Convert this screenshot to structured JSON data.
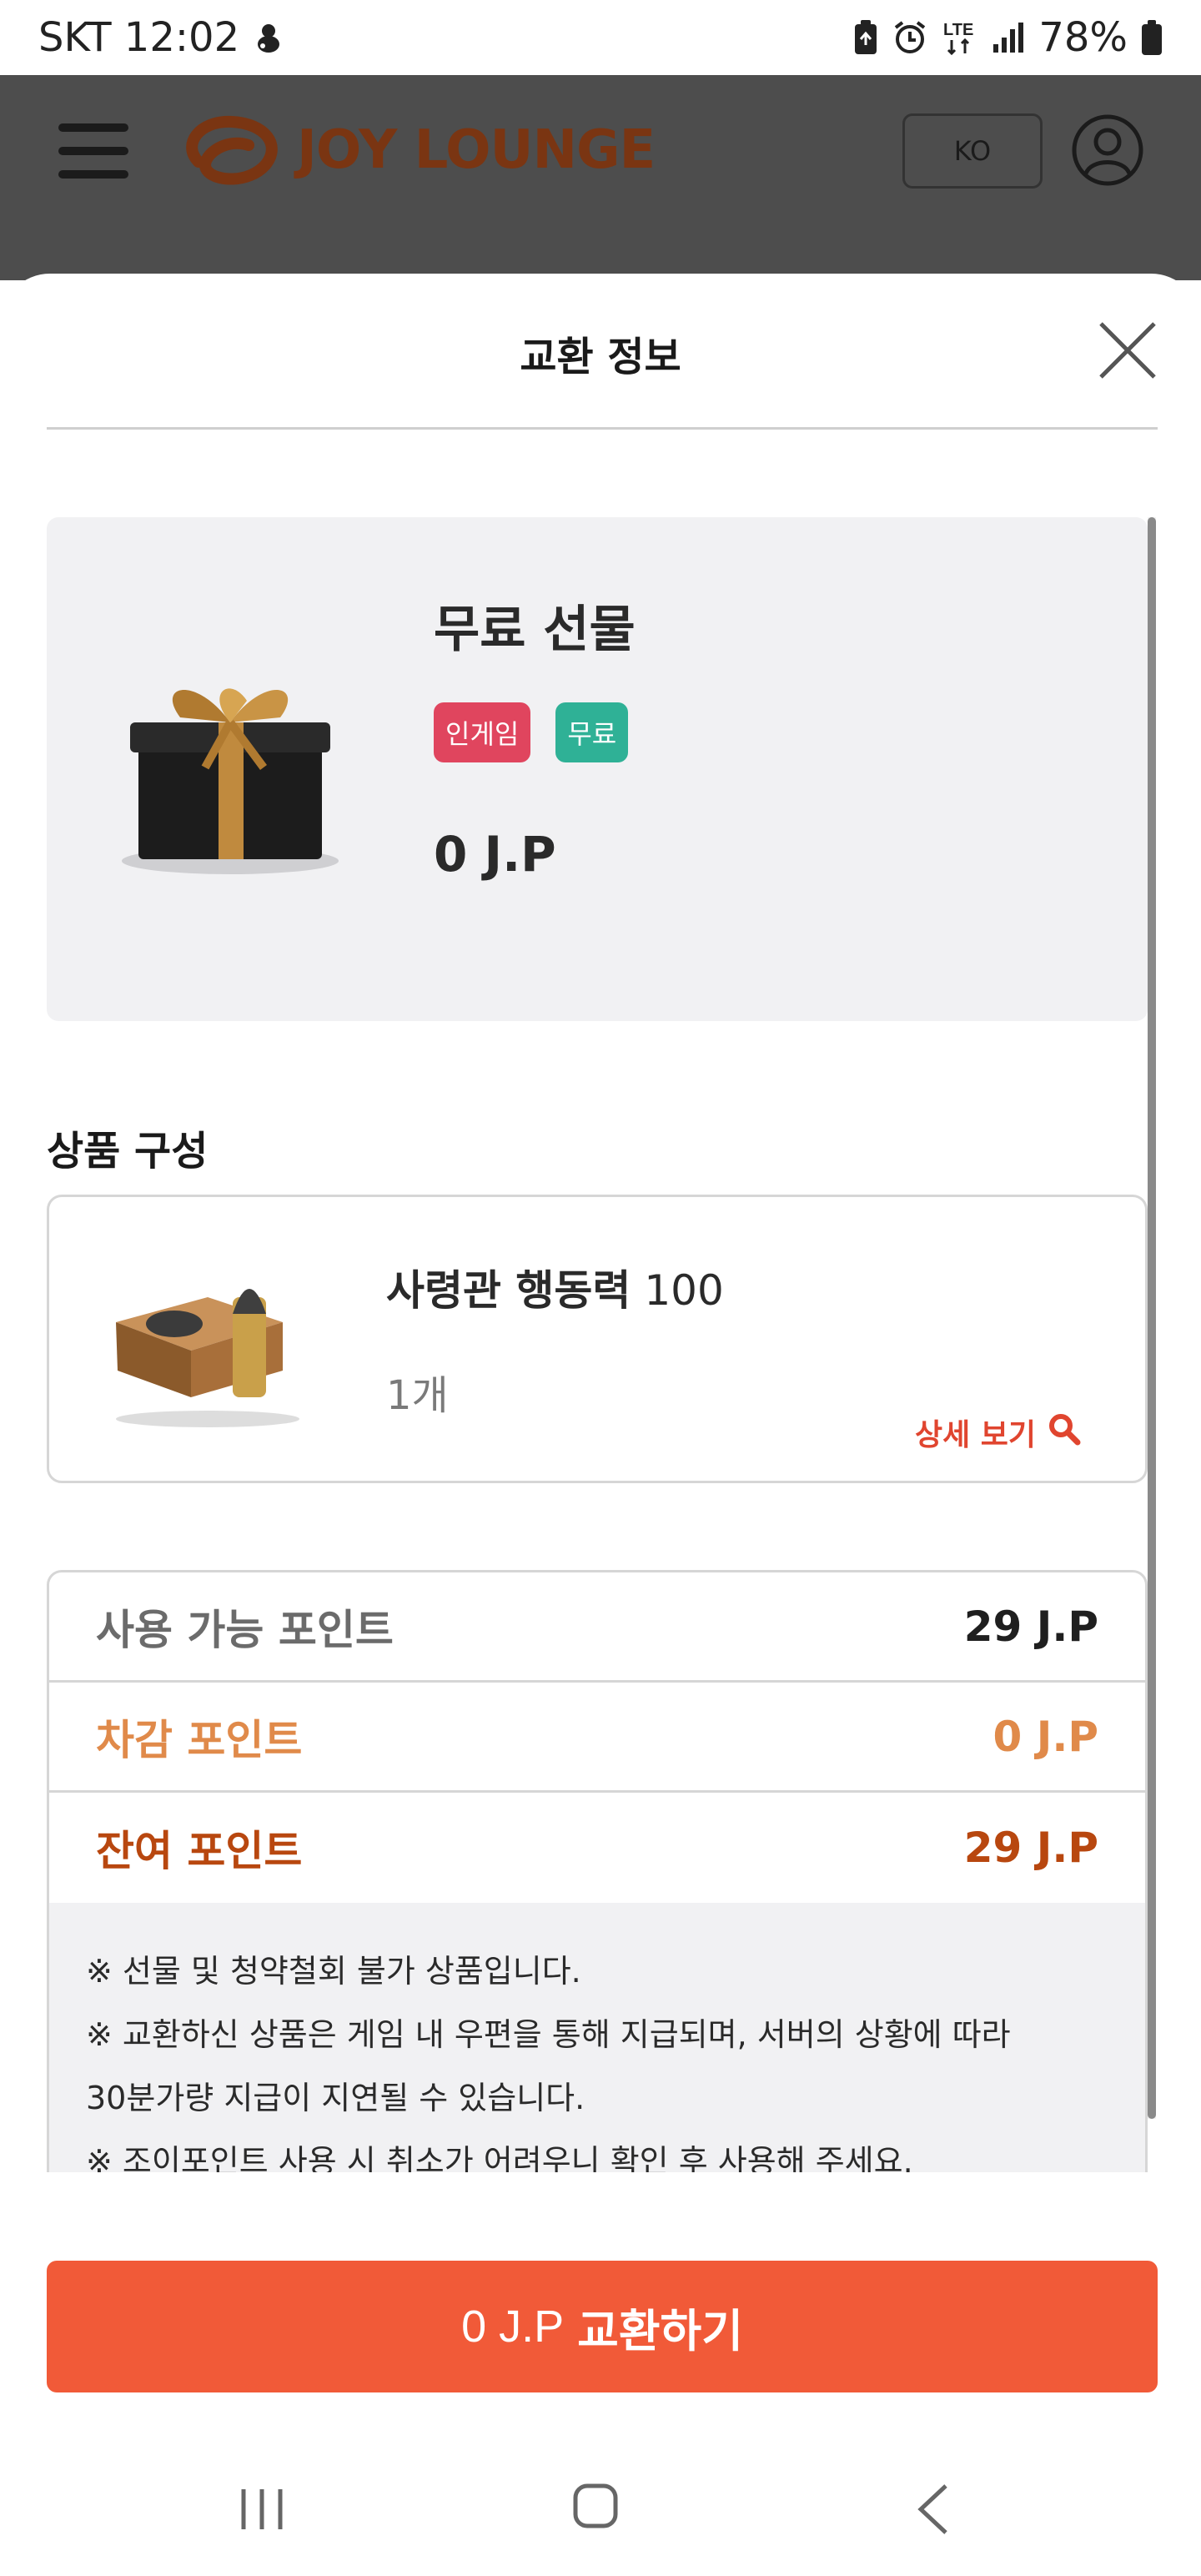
{
  "status_bar": {
    "carrier_time": "SKT 12:02",
    "battery": "78%",
    "network": "LTE"
  },
  "header": {
    "logo_text": "JOY LOUNGE",
    "lang_button": "KO"
  },
  "modal": {
    "title": "교환 정보",
    "product": {
      "name": "무료 선물",
      "tags": [
        "인게임",
        "무료"
      ],
      "price": "0 J.P"
    },
    "contents_section": {
      "title": "상품 구성",
      "item_name_bold": "사령관 행동력",
      "item_name_value": " 100",
      "item_qty": "1개",
      "detail_link": "상세 보기"
    },
    "points": {
      "available_label": "사용 가능 포인트",
      "available_value": "29 J.P",
      "deduct_label": "차감 포인트",
      "deduct_value": "0 J.P",
      "remain_label": "잔여 포인트",
      "remain_value": "29 J.P"
    },
    "notes": [
      "※ 선물 및 청약철회 불가 상품입니다.",
      "※ 교환하신 상품은 게임 내 우편을 통해 지급되며, 서버의 상황에 따라",
      "30분가량 지급이 지연될 수 있습니다.",
      "※ 조이포인트 사용 시 취소가 어려우니 확인 후 사용해 주세요."
    ],
    "exchange_button": {
      "amount": "0 J.P",
      "verb": "교환하기"
    }
  },
  "colors": {
    "accent": "#f15a38",
    "tag_ingame": "#e0455e",
    "tag_free": "#2fb196",
    "deduct": "#e08a4a",
    "remain": "#b8470f"
  },
  "icons": [
    "tamagotchi-icon",
    "battery-saver-icon",
    "alarm-icon",
    "lte-icon",
    "signal-icon",
    "battery-icon",
    "menu-icon",
    "joy-lounge-logo",
    "user-icon",
    "close-icon",
    "gift-box-image",
    "ammo-crate-image",
    "magnifier-icon",
    "nav-recent-icon",
    "nav-home-icon",
    "nav-back-icon"
  ]
}
